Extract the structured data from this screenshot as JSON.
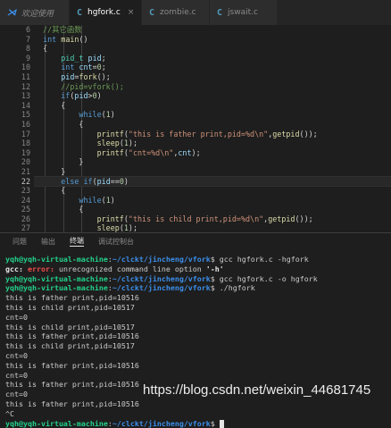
{
  "tabs": [
    {
      "icon": "vscode-icon",
      "glyph": "⋊",
      "label": "欢迎使用",
      "close": ""
    },
    {
      "icon": "c-file-icon",
      "glyph": "C",
      "label": "hgfork.c",
      "close": "×",
      "active": true
    },
    {
      "icon": "c-file-icon",
      "glyph": "C",
      "label": "zombie.c",
      "close": ""
    },
    {
      "icon": "c-file-icon",
      "glyph": "C",
      "label": "jswait.c",
      "close": ""
    }
  ],
  "editor": {
    "current_line": 22,
    "lines": [
      {
        "n": "6",
        "t": "  //其它函数"
      },
      {
        "n": "7",
        "t": "  int main()"
      },
      {
        "n": "8",
        "t": "  {"
      },
      {
        "n": "9",
        "t": "      pid_t pid;"
      },
      {
        "n": "10",
        "t": "      int cnt=0;"
      },
      {
        "n": "11",
        "t": "      pid=fork();"
      },
      {
        "n": "12",
        "t": "      //pid=vfork();"
      },
      {
        "n": "13",
        "t": "      if(pid>0)"
      },
      {
        "n": "14",
        "t": "      {"
      },
      {
        "n": "15",
        "t": "          while(1)"
      },
      {
        "n": "16",
        "t": "          {"
      },
      {
        "n": "17",
        "t": "              printf(\"this is father print,pid=%d\\n\",getpid());"
      },
      {
        "n": "18",
        "t": "              sleep(1);"
      },
      {
        "n": "19",
        "t": "              printf(\"cnt=%d\\n\",cnt);"
      },
      {
        "n": "20",
        "t": "          }"
      },
      {
        "n": "21",
        "t": "      }"
      },
      {
        "n": "22",
        "t": "      else if(pid==0)"
      },
      {
        "n": "23",
        "t": "      {"
      },
      {
        "n": "24",
        "t": "          while(1)"
      },
      {
        "n": "25",
        "t": "          {"
      },
      {
        "n": "26",
        "t": "              printf(\"this is child print,pid=%d\\n\",getpid());"
      },
      {
        "n": "27",
        "t": "              sleep(1);"
      }
    ]
  },
  "panel": {
    "tabs": [
      "问题",
      "输出",
      "终端",
      "调试控制台"
    ],
    "active_tab": "终端"
  },
  "terminal": {
    "user": "yqh@yqh-virtual-machine",
    "path": "~/clckt/jincheng/vfork",
    "lines": [
      {
        "type": "prompt",
        "cmd": " gcc hgfork.c -hgfork"
      },
      {
        "type": "error",
        "prefix": "gcc: ",
        "err": "error: ",
        "msg": "unrecognized command line option ",
        "quote": "'-h'"
      },
      {
        "type": "prompt",
        "cmd": " gcc hgfork.c -o hgfork"
      },
      {
        "type": "prompt",
        "cmd": " ./hgfork"
      },
      {
        "type": "out",
        "text": "this is father print,pid=10516"
      },
      {
        "type": "out",
        "text": "this is child print,pid=10517"
      },
      {
        "type": "out",
        "text": "cnt=0"
      },
      {
        "type": "out",
        "text": "this is child print,pid=10517"
      },
      {
        "type": "out",
        "text": "this is father print,pid=10516"
      },
      {
        "type": "out",
        "text": "this is child print,pid=10517"
      },
      {
        "type": "out",
        "text": "cnt=0"
      },
      {
        "type": "out",
        "text": "this is father print,pid=10516"
      },
      {
        "type": "out",
        "text": "cnt=0"
      },
      {
        "type": "out",
        "text": "this is father print,pid=10516"
      },
      {
        "type": "out",
        "text": "cnt=0"
      },
      {
        "type": "out",
        "text": "this is father print,pid=10516"
      },
      {
        "type": "out",
        "text": "^C"
      },
      {
        "type": "prompt_cursor",
        "cmd": " "
      }
    ]
  },
  "watermark": "https://blog.csdn.net/weixin_44681745"
}
